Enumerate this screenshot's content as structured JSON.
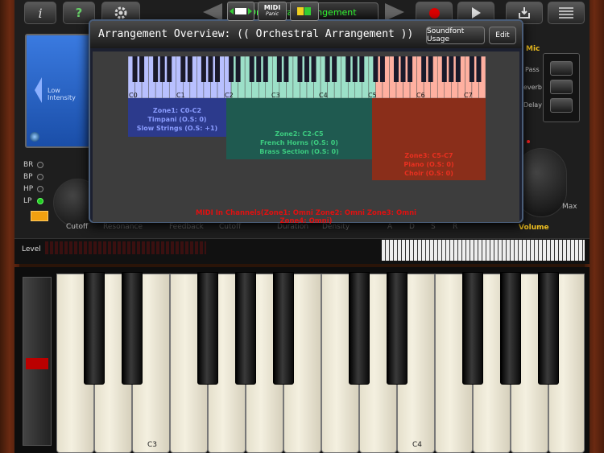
{
  "toolbar": {
    "info_label": "i",
    "help_label": "?",
    "preset_name": "Orchestral Arrangement"
  },
  "lcd": {
    "text": "Low Intensity"
  },
  "filters": [
    "BR",
    "BP",
    "HP",
    "LP"
  ],
  "bottom_labels": {
    "cutoff": "Cutoff",
    "resonance": "Resonance",
    "feedback": "Feedback",
    "cutoff2": "Cutoff",
    "duration": "Duration",
    "density": "Density",
    "adsr": [
      "A",
      "D",
      "S",
      "R"
    ],
    "volume": "Volume",
    "max": "Max"
  },
  "right_panel": {
    "mic": "Mic",
    "pass": "Pass",
    "reverb": "everb",
    "delay": "Delay"
  },
  "modal": {
    "title": "Arrangement Overview: (( Orchestral Arrangement ))",
    "soundfont_button": "Soundfont Usage",
    "edit_button": "Edit",
    "octave_labels": [
      "C0",
      "C1",
      "C2",
      "C3",
      "C4",
      "C5",
      "C6",
      "C7"
    ],
    "zones": [
      {
        "lines": [
          "Zone1: C0-C2",
          "Timpani (O.S: 0)",
          "Slow Strings (O.S: +1)"
        ],
        "color": "#6a78f0"
      },
      {
        "lines": [
          "Zone2: C2-C5",
          "French Horns (O.S: 0)",
          "Brass Section (O.S: 0)"
        ],
        "color": "#35b870"
      },
      {
        "lines": [
          "Zone3: C5-C7",
          "Piano (O.S: 0)",
          "Choir (O.S: 0)"
        ],
        "color": "#e03020"
      }
    ],
    "midi_channels": "MIDI In Channels(Zone1: Omni   Zone2: Omni   Zone3: Omni   Zone4: Omni)"
  },
  "strip": {
    "level_label": "Level",
    "midi_label": "MIDI",
    "panic_label": "Panic"
  },
  "keyboard": {
    "labels": [
      "C3",
      "C4"
    ]
  },
  "colors": {
    "zone1_bg": "#2c3a8c",
    "zone2_bg": "#1f5a50",
    "zone3_bg": "#8a2e1a",
    "accent_red": "#e01010",
    "preset_green": "#33ff33"
  }
}
